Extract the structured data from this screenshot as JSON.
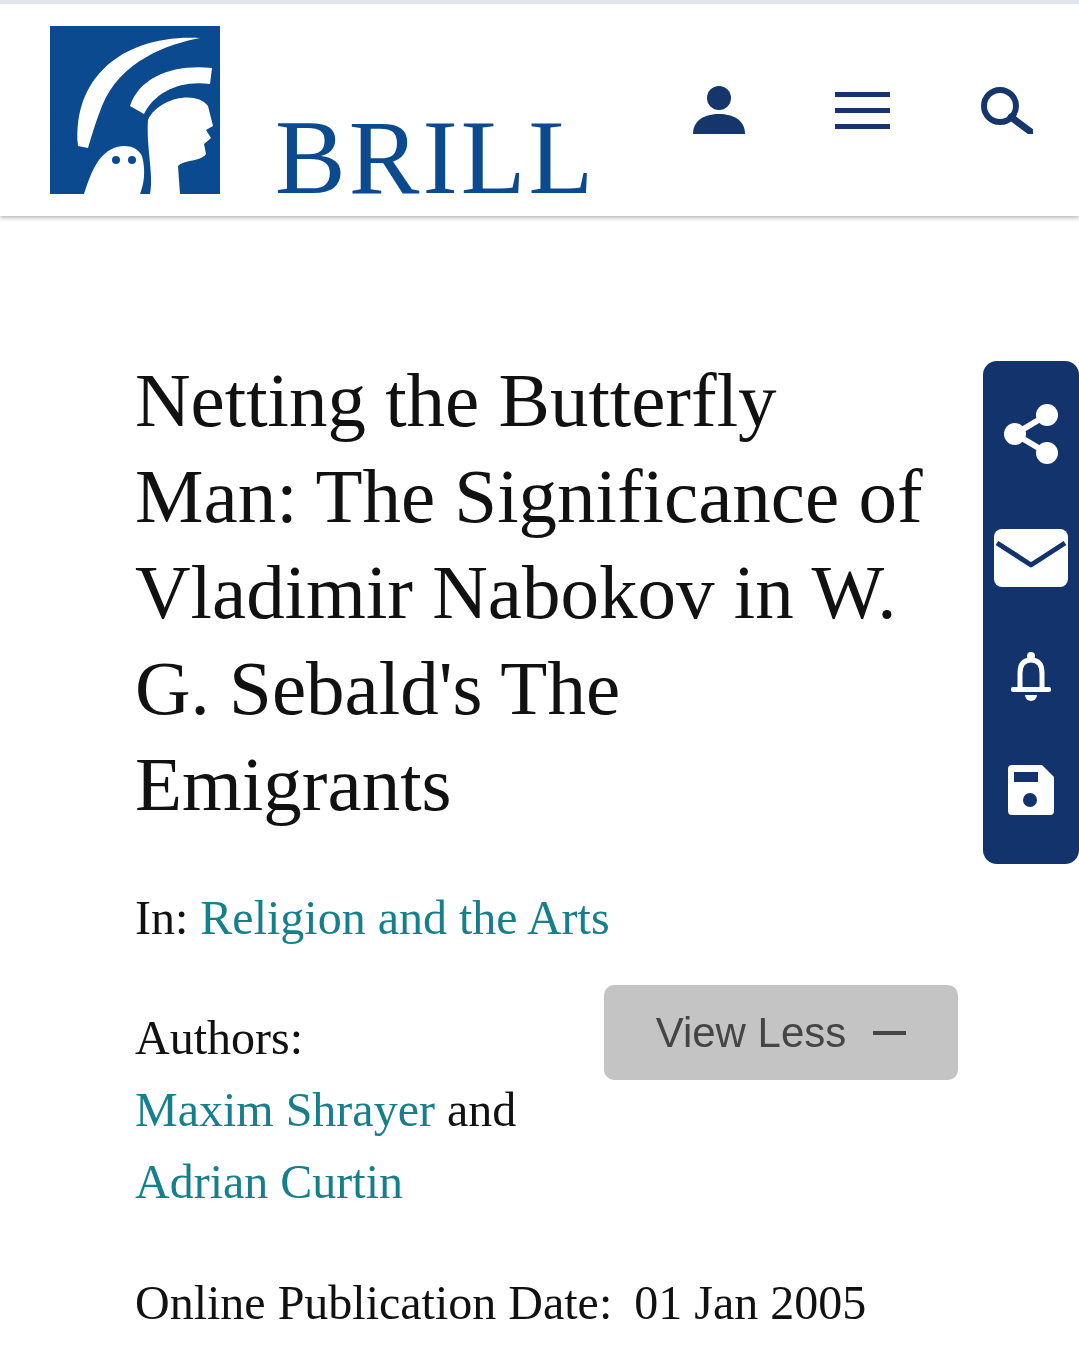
{
  "header": {
    "brand": "BRILL"
  },
  "article": {
    "title": "Netting the Butterfly Man: The Significance of Vladimir Nabokov in W. G. Sebald's The Emigrants",
    "in_label": "In:",
    "journal": "Religion and the Arts",
    "authors_label": "Authors:",
    "authors": [
      "Maxim Shrayer",
      "Adrian Curtin"
    ],
    "author_joiner": "and",
    "toggle_button": {
      "label": "View Less",
      "expanded": true
    },
    "publication_date": {
      "label": "Online Publication Date:",
      "value": "01 Jan 2005"
    }
  }
}
